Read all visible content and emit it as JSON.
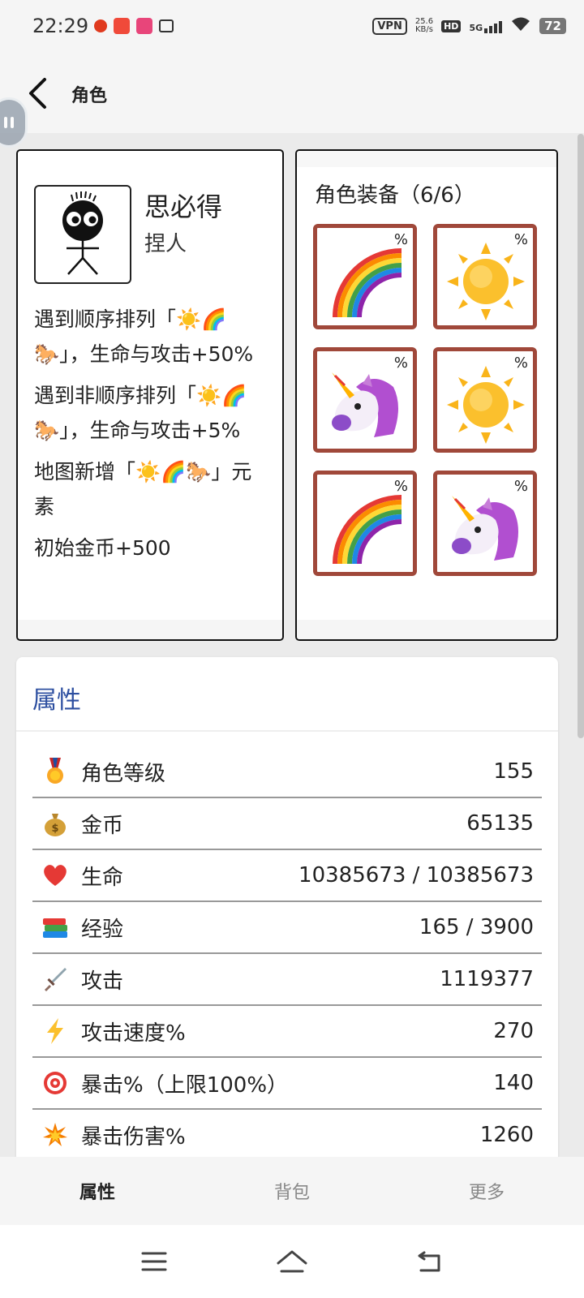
{
  "status_bar": {
    "time": "22:29",
    "vpn": "VPN",
    "speed_value": "25.6",
    "speed_unit": "KB/s",
    "hd": "HD",
    "network": "5G",
    "battery": "72"
  },
  "header": {
    "title": "角色"
  },
  "character": {
    "name": "思必得",
    "type": "捏人",
    "skills": [
      "遇到顺序排列「☀️🌈🐎」，生命与攻击+50%",
      "遇到非顺序排列「☀️🌈🐎」，生命与攻击+5%",
      "地图新增「☀️🌈🐎」元素",
      "初始金币+500"
    ]
  },
  "equipment": {
    "title": "角色装备（6/6）",
    "slots": [
      {
        "icon": "rainbow-icon",
        "badge": "%"
      },
      {
        "icon": "sun-icon",
        "badge": "%"
      },
      {
        "icon": "unicorn-icon",
        "badge": "%"
      },
      {
        "icon": "sun-icon",
        "badge": "%"
      },
      {
        "icon": "rainbow-icon",
        "badge": "%"
      },
      {
        "icon": "unicorn-icon",
        "badge": "%"
      }
    ]
  },
  "attributes": {
    "title": "属性",
    "rows": [
      {
        "icon": "medal-icon",
        "label": "角色等级",
        "value": "155"
      },
      {
        "icon": "money-bag-icon",
        "label": "金币",
        "value": "65135"
      },
      {
        "icon": "heart-icon",
        "label": "生命",
        "value": "10385673 / 10385673"
      },
      {
        "icon": "books-icon",
        "label": "经验",
        "value": "165 / 3900"
      },
      {
        "icon": "dagger-icon",
        "label": "攻击",
        "value": "1119377"
      },
      {
        "icon": "lightning-icon",
        "label": "攻击速度%",
        "value": "270"
      },
      {
        "icon": "target-icon",
        "label": "暴击%（上限100%）",
        "value": "140"
      },
      {
        "icon": "explosion-icon",
        "label": "暴击伤害%",
        "value": "1260"
      }
    ]
  },
  "tabs": [
    {
      "label": "属性",
      "active": true
    },
    {
      "label": "背包",
      "active": false
    },
    {
      "label": "更多",
      "active": false
    }
  ],
  "colors": {
    "accent": "#2d4fa0",
    "slot_border": "#a0483a"
  }
}
